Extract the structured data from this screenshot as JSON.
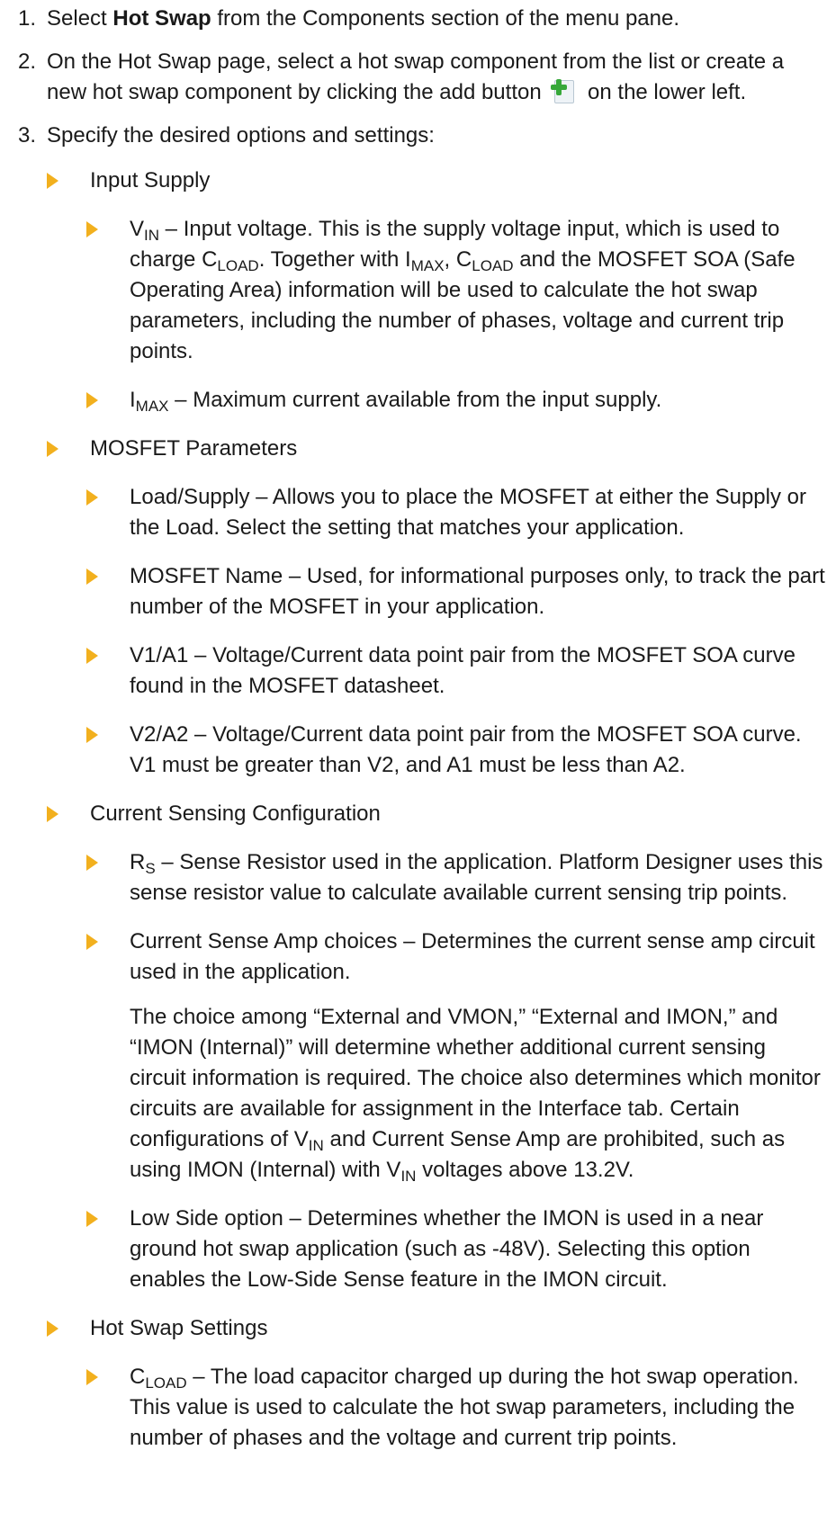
{
  "steps": [
    {
      "num": "1.",
      "before": "Select ",
      "bold": "Hot Swap",
      "after": " from the Components section of the menu pane."
    },
    {
      "num": "2.",
      "before": "On the Hot Swap page, select a hot swap component from the list or create a new hot swap component by clicking the add button",
      "after": "on the lower left."
    },
    {
      "num": "3.",
      "text": "Specify the desired options and settings:"
    }
  ],
  "icons": {
    "add": "add-component-icon",
    "bullet": "triangle-bullet-icon",
    "bullet_color": "#f2b01e"
  },
  "input_supply": {
    "title": "Input Supply",
    "vin": {
      "sym": "V",
      "sub": "IN",
      "t1": " – Input voltage. This is the supply voltage input, which is used to charge ",
      "cload_sym": "C",
      "cload_sub": "LOAD",
      "t2": ". Together with ",
      "imax_sym": "I",
      "imax_sub": "MAX",
      "t3": ", ",
      "cload2_sym": "C",
      "cload2_sub": "LOAD",
      "t4": " and the MOSFET SOA (Safe Operating Area) information will be used to calculate the hot swap parameters, including the number of phases, voltage and current trip points."
    },
    "imax": {
      "sym": "I",
      "sub": "MAX",
      "t1": " – Maximum current available from the input supply."
    }
  },
  "mosfet": {
    "title": "MOSFET Parameters",
    "items": [
      "Load/Supply – Allows you to place the MOSFET at either the Supply or the Load. Select the setting that matches your application.",
      "MOSFET Name – Used, for informational purposes only, to track the part number of the MOSFET in your application.",
      "V1/A1 – Voltage/Current data point pair from the MOSFET SOA curve found in the MOSFET datasheet.",
      "V2/A2 – Voltage/Current data point pair from the MOSFET SOA curve. V1 must be greater than V2, and A1 must be less than A2."
    ]
  },
  "current_sensing": {
    "title": "Current Sensing Configuration",
    "rs": {
      "sym": "R",
      "sub": "S",
      "t1": " – Sense Resistor used in the application. Platform Designer uses this sense resistor value to calculate available current sensing trip points."
    },
    "amp": "Current Sense Amp choices – Determines the current sense amp circuit used in the application.",
    "note": {
      "t1": "The choice among “External and VMON,” “External and IMON,” and “IMON (Internal)” will determine whether additional current sensing circuit information is required. The choice also determines which monitor circuits are available for assignment in the Interface tab. Certain configurations of ",
      "vin_sym": "V",
      "vin_sub": "IN",
      "t2": " and Current Sense Amp are prohibited, such as using IMON (Internal) with ",
      "vin2_sym": "V",
      "vin2_sub": "IN",
      "t3": " voltages above 13.2V."
    },
    "low_side": "Low Side option – Determines whether the IMON is used in a near ground hot swap application (such as -48V). Selecting this option enables the Low-Side Sense feature in the IMON circuit."
  },
  "hot_swap_settings": {
    "title": "Hot Swap Settings",
    "cload": {
      "sym": "C",
      "sub": "LOAD",
      "t1": " – The load capacitor charged up during the hot swap operation. This value is used to calculate the hot swap parameters, including the number of phases and the voltage and current trip points."
    }
  }
}
